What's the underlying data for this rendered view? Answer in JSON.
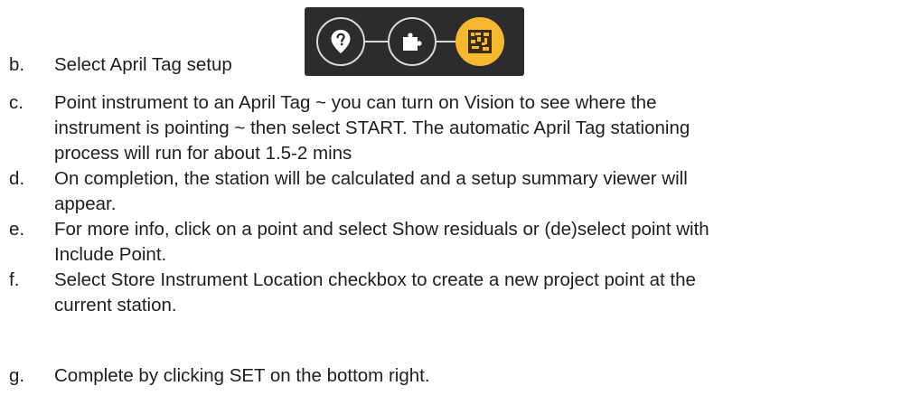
{
  "list": {
    "items": [
      {
        "marker": "b.",
        "lines": [
          "Select April Tag setup"
        ]
      },
      {
        "marker": "c.",
        "lines": [
          "Point instrument to an April Tag ~ you can turn on Vision to see where the",
          "instrument is pointing ~ then select START. The automatic April Tag stationing",
          "process will run for about 1.5-2 mins"
        ]
      },
      {
        "marker": "d.",
        "lines": [
          "On completion, the station will be calculated and a setup summary viewer will",
          "appear."
        ]
      },
      {
        "marker": "e.",
        "lines": [
          "For more info, click on a point and select Show residuals or (de)select point with",
          "Include Point."
        ]
      },
      {
        "marker": "f.",
        "lines": [
          "Select Store Instrument Location checkbox to create a new project point at the",
          "current station."
        ]
      },
      {
        "marker": "g.",
        "lines": [
          "Complete by clicking SET on the bottom right."
        ]
      }
    ]
  },
  "toolbar": {
    "buttons": [
      {
        "icon": "help-marker-icon"
      },
      {
        "icon": "puzzle-piece-icon"
      },
      {
        "icon": "april-tag-icon",
        "active": true
      }
    ],
    "colors": {
      "background": "#2c2c2e",
      "outline": "#d9d9d9",
      "active": "#f5b82e",
      "active_glyph": "#3a2d0c"
    }
  }
}
